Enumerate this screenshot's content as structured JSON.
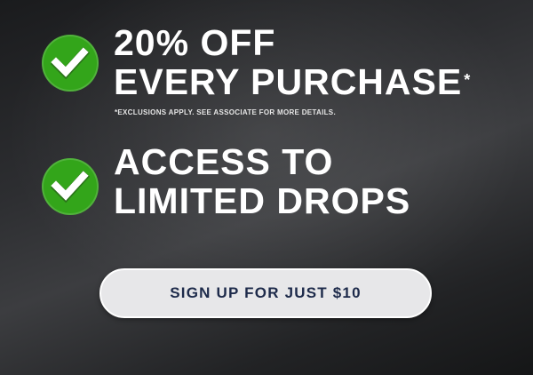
{
  "colors": {
    "badge_green": "#33a51a",
    "headline_text": "#ffffff",
    "button_bg": "#e7e7e9",
    "button_text": "#1d2a4a"
  },
  "benefits": [
    {
      "icon": "check-icon",
      "line1": "20% OFF",
      "line2": "EVERY PURCHASE",
      "asterisk": "*",
      "disclaimer": "*EXCLUSIONS APPLY. SEE ASSOCIATE FOR MORE DETAILS."
    },
    {
      "icon": "check-icon",
      "line1": "ACCESS TO",
      "line2": "LIMITED DROPS"
    }
  ],
  "cta": {
    "label": "SIGN UP FOR JUST $10"
  }
}
